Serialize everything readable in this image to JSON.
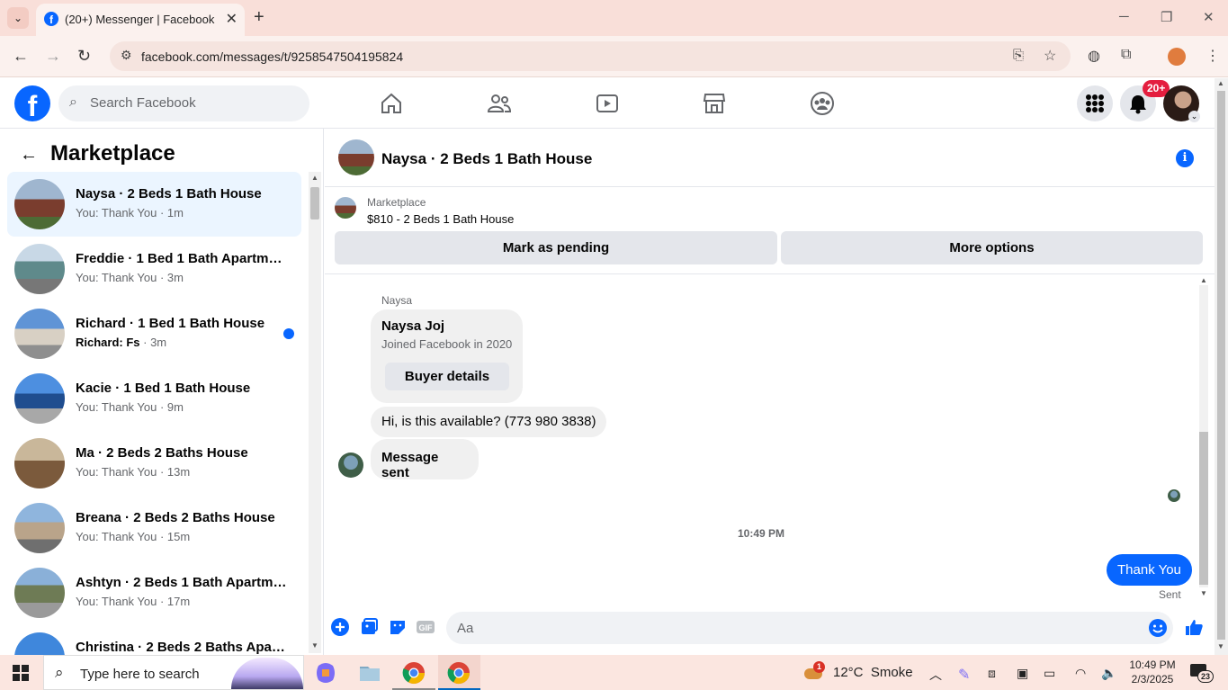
{
  "browser": {
    "tab_title": "(20+) Messenger | Facebook",
    "url": "facebook.com/messages/t/9258547504195824"
  },
  "fb_header": {
    "search_placeholder": "Search Facebook",
    "notification_badge": "20+"
  },
  "left_panel": {
    "heading": "Marketplace",
    "conversations": [
      {
        "name": "Naysa · 2 Beds 1 Bath House",
        "sub": "You: Thank You · 1m",
        "active": true,
        "unread": false
      },
      {
        "name": "Freddie · 1 Bed 1 Bath Apartment",
        "sub": "You: Thank You · 3m",
        "active": false,
        "unread": false
      },
      {
        "name": "Richard · 1 Bed 1 Bath House",
        "sub_name": "Richard: Fs",
        "sub_time": " · 3m",
        "active": false,
        "unread": true
      },
      {
        "name": "Kacie · 1 Bed 1 Bath House",
        "sub": "You: Thank You · 9m",
        "active": false,
        "unread": false
      },
      {
        "name": "Ma · 2 Beds 2 Baths House",
        "sub": "You: Thank You · 13m",
        "active": false,
        "unread": false
      },
      {
        "name": "Breana · 2 Beds 2 Baths House",
        "sub": "You: Thank You · 15m",
        "active": false,
        "unread": false
      },
      {
        "name": "Ashtyn · 2 Beds 1 Bath Apartment",
        "sub": "You: Thank You · 17m",
        "active": false,
        "unread": false
      },
      {
        "name": "Christina · 2 Beds 2 Baths Apartment",
        "sub": "",
        "active": false,
        "unread": false
      }
    ]
  },
  "conversation": {
    "title": "Naysa · 2 Beds 1 Bath House",
    "listing_label": "Marketplace",
    "listing_price": "$810 - 2 Beds 1 Bath House",
    "mark_pending_label": "Mark as pending",
    "more_options_label": "More options",
    "sender_name": "Naysa",
    "profile_card_name": "Naysa Joj",
    "profile_card_joined": "Joined Facebook in 2020",
    "buyer_details_label": "Buyer details",
    "msg_available": "Hi, is this available? (773 980 3838)",
    "msg_sent_notice": "Message sent",
    "timestamp": "10:49 PM",
    "my_msg": "Thank You",
    "my_msg_status": "Sent",
    "composer_placeholder": "Aa"
  },
  "taskbar": {
    "search_placeholder": "Type here to search",
    "weather": "12°C  Smoke",
    "weather_badge": "1",
    "time": "10:49 PM",
    "date": "2/3/2025",
    "notif_count": "23"
  }
}
